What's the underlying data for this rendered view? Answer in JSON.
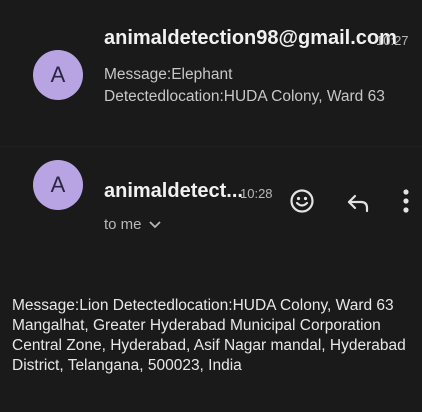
{
  "email1": {
    "avatar_letter": "A",
    "sender": "animaldetection98@gmail.com",
    "time": "10:27",
    "preview_line1": "Message:Elephant",
    "preview_line2": "Detectedlocation:HUDA Colony, Ward 63"
  },
  "email2": {
    "avatar_letter": "A",
    "sender": "animaldetect...",
    "time": "10:28",
    "recipient": "to me",
    "body": "Message:Lion Detectedlocation:HUDA Colony, Ward 63 Mangalhat, Greater Hyderabad Municipal Corporation Central Zone, Hyderabad, Asif Nagar mandal, Hyderabad District, Telangana, 500023, India"
  },
  "icons": {
    "emoji_reaction": "smiley-face-icon",
    "reply": "reply-arrow-icon",
    "more": "more-vertical-icon",
    "expand": "chevron-down-icon"
  },
  "colors": {
    "background": "#1a1a1a",
    "avatar": "#b8a4e3"
  }
}
